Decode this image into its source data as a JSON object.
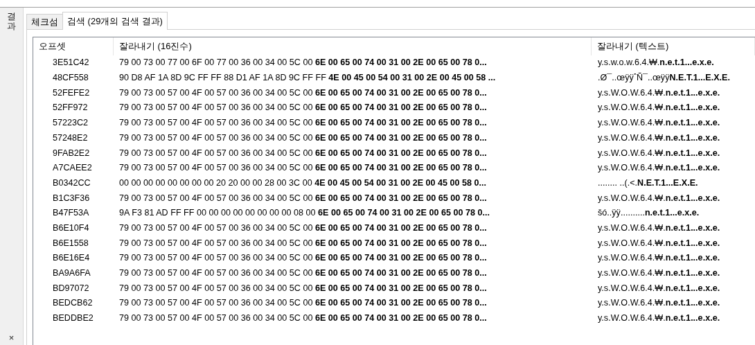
{
  "side_panel": {
    "label": "결과",
    "close": "×"
  },
  "tabs": [
    {
      "label": "체크섬",
      "selected": false
    },
    {
      "label": "검색 (29개의 검색 결과)",
      "selected": true
    }
  ],
  "table": {
    "columns": [
      "오프셋",
      "잘라내기 (16진수)",
      "잘라내기 (텍스트)"
    ],
    "rows": [
      {
        "offset": "3E51C42",
        "hex": "79 00 73 00 77 00 6F 00 77 00 36 00 34 00 5C 00 **6E 00 65 00 74 00 31 00 2E 00 65 00 78 0...**",
        "text": "y.s.w.o.w.6.4.₩.**n.e.t.1...e.x.e.**"
      },
      {
        "offset": "48CF558",
        "hex": "90 D8 AF 1A 8D 9C FF FF 88 D1 AF 1A 8D 9C FF FF **4E 00 45 00 54 00 31 00 2E 00 45 00 58 ...**",
        "text": ".Ø¯..œÿÿˆÑ¯..œÿÿ**N.E.T.1...E.X.E.**"
      },
      {
        "offset": "52FEFE2",
        "hex": "79 00 73 00 57 00 4F 00 57 00 36 00 34 00 5C 00 **6E 00 65 00 74 00 31 00 2E 00 65 00 78 0...**",
        "text": "y.s.W.O.W.6.4.₩.**n.e.t.1...e.x.e.**"
      },
      {
        "offset": "52FF972",
        "hex": "79 00 73 00 57 00 4F 00 57 00 36 00 34 00 5C 00 **6E 00 65 00 74 00 31 00 2E 00 65 00 78 0...**",
        "text": "y.s.W.O.W.6.4.₩.**n.e.t.1...e.x.e.**"
      },
      {
        "offset": "57223C2",
        "hex": "79 00 73 00 57 00 4F 00 57 00 36 00 34 00 5C 00 **6E 00 65 00 74 00 31 00 2E 00 65 00 78 0...**",
        "text": "y.s.W.O.W.6.4.₩.**n.e.t.1...e.x.e.**"
      },
      {
        "offset": "57248E2",
        "hex": "79 00 73 00 57 00 4F 00 57 00 36 00 34 00 5C 00 **6E 00 65 00 74 00 31 00 2E 00 65 00 78 0...**",
        "text": "y.s.W.O.W.6.4.₩.**n.e.t.1...e.x.e.**"
      },
      {
        "offset": "9FAB2E2",
        "hex": "79 00 73 00 57 00 4F 00 57 00 36 00 34 00 5C 00 **6E 00 65 00 74 00 31 00 2E 00 65 00 78 0...**",
        "text": "y.s.W.O.W.6.4.₩.**n.e.t.1...e.x.e.**"
      },
      {
        "offset": "A7CAEE2",
        "hex": "79 00 73 00 57 00 4F 00 57 00 36 00 34 00 5C 00 **6E 00 65 00 74 00 31 00 2E 00 65 00 78 0...**",
        "text": "y.s.W.O.W.6.4.₩.**n.e.t.1...e.x.e.**"
      },
      {
        "offset": "B0342CC",
        "hex": "00 00 00 00 00 00 00 00 20 20 00 00 28 00 3C 00 **4E 00 45 00 54 00 31 00 2E 00 45 00 58 0...**",
        "text": "........  ..(.<.**N.E.T.1...E.X.E.**"
      },
      {
        "offset": "B1C3F36",
        "hex": "79 00 73 00 57 00 4F 00 57 00 36 00 34 00 5C 00 **6E 00 65 00 74 00 31 00 2E 00 65 00 78 0...**",
        "text": "y.s.W.O.W.6.4.₩.**n.e.t.1...e.x.e.**"
      },
      {
        "offset": "B47F53A",
        "hex": "9A F3 81 AD FF FF 00 00 00 00 00 00 00 00 08 00 **6E 00 65 00 74 00 31 00 2E 00 65 00 78 0...**",
        "text": "šó..ÿÿ..........**n.e.t.1...e.x.e.**"
      },
      {
        "offset": "B6E10F4",
        "hex": "79 00 73 00 57 00 4F 00 57 00 36 00 34 00 5C 00 **6E 00 65 00 74 00 31 00 2E 00 65 00 78 0...**",
        "text": "y.s.W.O.W.6.4.₩.**n.e.t.1...e.x.e.**"
      },
      {
        "offset": "B6E1558",
        "hex": "79 00 73 00 57 00 4F 00 57 00 36 00 34 00 5C 00 **6E 00 65 00 74 00 31 00 2E 00 65 00 78 0...**",
        "text": "y.s.W.O.W.6.4.₩.**n.e.t.1...e.x.e.**"
      },
      {
        "offset": "B6E16E4",
        "hex": "79 00 73 00 57 00 4F 00 57 00 36 00 34 00 5C 00 **6E 00 65 00 74 00 31 00 2E 00 65 00 78 0...**",
        "text": "y.s.W.O.W.6.4.₩.**n.e.t.1...e.x.e.**"
      },
      {
        "offset": "BA9A6FA",
        "hex": "79 00 73 00 57 00 4F 00 57 00 36 00 34 00 5C 00 **6E 00 65 00 74 00 31 00 2E 00 65 00 78 0...**",
        "text": "y.s.W.O.W.6.4.₩.**n.e.t.1...e.x.e.**"
      },
      {
        "offset": "BD97072",
        "hex": "79 00 73 00 57 00 4F 00 57 00 36 00 34 00 5C 00 **6E 00 65 00 74 00 31 00 2E 00 65 00 78 0...**",
        "text": "y.s.W.O.W.6.4.₩.**n.e.t.1...e.x.e.**"
      },
      {
        "offset": "BEDCB62",
        "hex": "79 00 73 00 57 00 4F 00 57 00 36 00 34 00 5C 00 **6E 00 65 00 74 00 31 00 2E 00 65 00 78 0...**",
        "text": "y.s.W.O.W.6.4.₩.**n.e.t.1...e.x.e.**"
      },
      {
        "offset": "BEDDBE2",
        "hex": "79 00 73 00 57 00 4F 00 57 00 36 00 34 00 5C 00 **6E 00 65 00 74 00 31 00 2E 00 65 00 78 0...**",
        "text": "y.s.W.O.W.6.4.₩.**n.e.t.1...e.x.e.**"
      }
    ]
  }
}
